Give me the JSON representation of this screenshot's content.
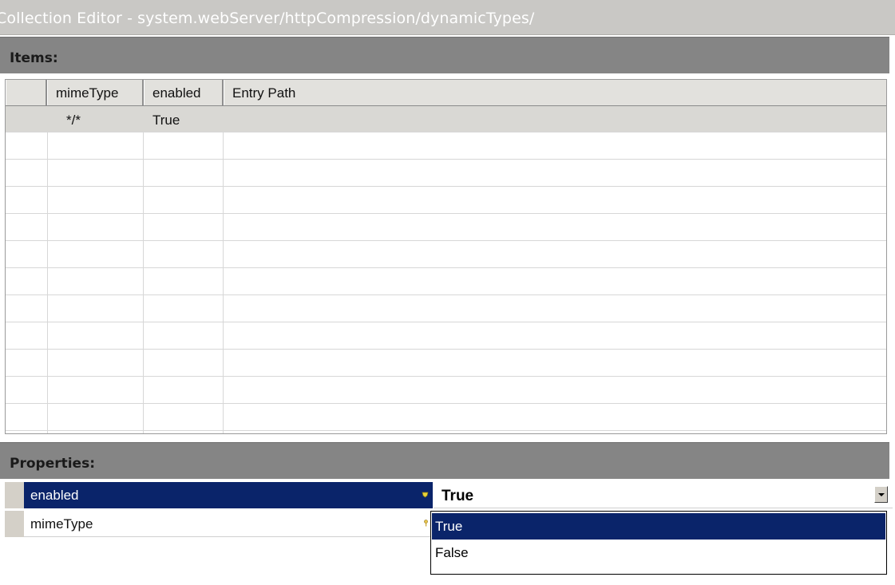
{
  "window": {
    "title": "Collection Editor - system.webServer/httpCompression/dynamicTypes/"
  },
  "items_section": {
    "header": "Items:",
    "columns": [
      "",
      "mimeType",
      "enabled",
      "Entry Path"
    ],
    "rows": [
      {
        "mimeType": "*/*",
        "enabled": "True",
        "entry_path": ""
      }
    ]
  },
  "properties_section": {
    "header": "Properties:",
    "rows": [
      {
        "name": "enabled",
        "value": "True",
        "selected": true
      },
      {
        "name": "mimeType",
        "value": "",
        "selected": false
      }
    ],
    "dropdown": {
      "options": [
        "True",
        "False"
      ],
      "selected": "True"
    }
  },
  "colors": {
    "selection": "#0a246a",
    "header_bar": "#858585",
    "title_bar": "#c9c8c5"
  }
}
